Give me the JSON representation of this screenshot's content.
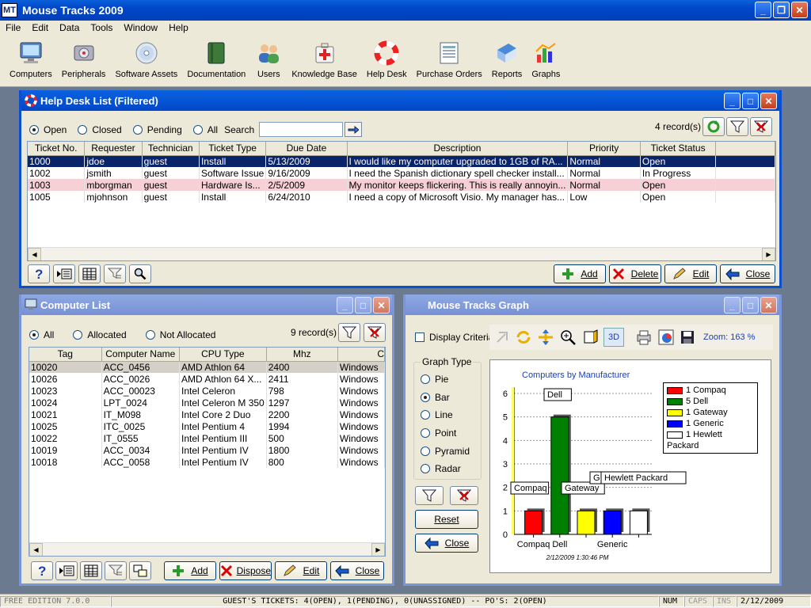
{
  "app": {
    "title": "Mouse Tracks 2009",
    "logo": "MT"
  },
  "menu": [
    "File",
    "Edit",
    "Data",
    "Tools",
    "Window",
    "Help"
  ],
  "toolbar": [
    {
      "label": "Computers",
      "icon": "monitor-icon"
    },
    {
      "label": "Peripherals",
      "icon": "hard-drive-icon"
    },
    {
      "label": "Software Assets",
      "icon": "cd-icon"
    },
    {
      "label": "Documentation",
      "icon": "book-icon"
    },
    {
      "label": "Users",
      "icon": "users-icon"
    },
    {
      "label": "Knowledge Base",
      "icon": "first-aid-kit-icon"
    },
    {
      "label": "Help Desk",
      "icon": "lifebuoy-icon"
    },
    {
      "label": "Purchase Orders",
      "icon": "document-icon"
    },
    {
      "label": "Reports",
      "icon": "reports-icon"
    },
    {
      "label": "Graphs",
      "icon": "graph-icon"
    }
  ],
  "helpdesk": {
    "title": "Help Desk List (Filtered)",
    "filters": [
      "Open",
      "Closed",
      "Pending",
      "All"
    ],
    "search_label": "Search",
    "search_value": "",
    "record_count": "4 record(s)",
    "columns": [
      "Ticket No.",
      "Requester",
      "Technician",
      "Ticket Type",
      "Due Date",
      "Description",
      "Priority",
      "Ticket Status"
    ],
    "rows": [
      [
        "1000",
        "jdoe",
        "guest",
        "Install",
        "5/13/2009",
        "I would like my computer upgraded to 1GB of RA...",
        "Normal",
        "Open"
      ],
      [
        "1002",
        "jsmith",
        "guest",
        "Software Issue",
        "9/16/2009",
        "I need the Spanish dictionary spell checker install...",
        "Normal",
        "In Progress"
      ],
      [
        "1003",
        "mborgman",
        "guest",
        "Hardware Is...",
        "2/5/2009",
        "My monitor keeps flickering.  This is really annoyin...",
        "Normal",
        "Open"
      ],
      [
        "1005",
        "mjohnson",
        "guest",
        "Install",
        "6/24/2010",
        "I need a copy of Microsoft Visio.  My manager has...",
        "Low",
        "Open"
      ]
    ],
    "buttons": {
      "add": "Add",
      "delete": "Delete",
      "edit": "Edit",
      "close": "Close"
    }
  },
  "computers": {
    "title": "Computer List",
    "filters": [
      "All",
      "Allocated",
      "Not Allocated"
    ],
    "record_count": "9 record(s)",
    "columns": [
      "Tag",
      "Computer Name",
      "CPU Type",
      "Mhz",
      "C"
    ],
    "rows": [
      [
        "10020",
        "ACC_0456",
        "AMD Athlon 64",
        "2400",
        "Windows"
      ],
      [
        "10026",
        "ACC_0026",
        "AMD Athlon 64 X...",
        "2411",
        "Windows"
      ],
      [
        "10023",
        "ACC_00023",
        "Intel Celeron",
        "798",
        "Windows"
      ],
      [
        "10024",
        "LPT_0024",
        "Intel Celeron M 350",
        "1297",
        "Windows"
      ],
      [
        "10021",
        "IT_M098",
        "Intel Core 2 Duo",
        "2200",
        "Windows"
      ],
      [
        "10025",
        "ITC_0025",
        "Intel Pentium 4",
        "1994",
        "Windows"
      ],
      [
        "10022",
        "IT_0555",
        "Intel Pentium III",
        "500",
        "Windows"
      ],
      [
        "10019",
        "ACC_0034",
        "Intel Pentium IV",
        "1800",
        "Windows"
      ],
      [
        "10018",
        "ACC_0058",
        "Intel Pentium IV",
        "800",
        "Windows"
      ]
    ],
    "buttons": {
      "add": "Add",
      "dispose": "Dispose",
      "edit": "Edit",
      "close": "Close"
    }
  },
  "graph_window": {
    "title": "Mouse Tracks Graph",
    "display_criteria": "Display Criteria",
    "graph_type_label": "Graph Type",
    "graph_types": [
      "Pie",
      "Bar",
      "Line",
      "Point",
      "Pyramid",
      "Radar"
    ],
    "selected_type": "Bar",
    "mode_3d": "3D",
    "zoom": "Zoom: 163 %",
    "reset": "Reset",
    "close": "Close",
    "timestamp": "2/12/2009 1:30:46 PM"
  },
  "chart_data": {
    "type": "bar",
    "title": "Computers by Manufacturer",
    "categories": [
      "Compaq",
      "Dell",
      "Gateway",
      "Generic",
      "Hewlett Packard"
    ],
    "values": [
      1,
      5,
      1,
      1,
      1
    ],
    "x_tick_labels": [
      "Compaq",
      "Dell",
      "",
      "Generic",
      ""
    ],
    "ylim": [
      0,
      6
    ],
    "yticks": [
      0,
      1,
      2,
      3,
      4,
      5,
      6
    ],
    "colors": [
      "#ff0000",
      "#008000",
      "#ffff00",
      "#0000ff",
      "#ffffff"
    ],
    "legend": [
      "1 Compaq",
      "5 Dell",
      "1 Gateway",
      "1 Generic",
      "1 Hewlett Packard"
    ],
    "legend_position": "top-right",
    "callouts": [
      "Compaq",
      "Dell",
      "Gateway",
      "G",
      "Hewlett Packard"
    ],
    "grid": true
  },
  "status": {
    "edition": "FREE EDITION 7.0.0",
    "message": "GUEST'S TICKETS: 4(OPEN), 1(PENDING), 0(UNASSIGNED) -- PO'S: 2(OPEN)",
    "num": "NUM",
    "caps": "CAPS",
    "ins": "INS",
    "date": "2/12/2009"
  }
}
